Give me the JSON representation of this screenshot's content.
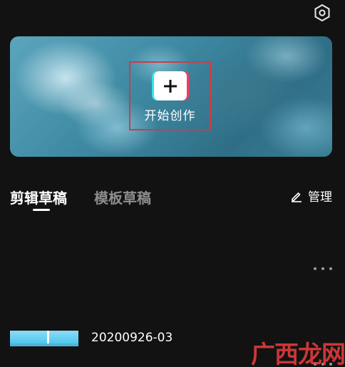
{
  "header": {
    "settings_icon": "settings-hexagon-icon"
  },
  "banner": {
    "create_label": "开始创作",
    "plus_icon": "plus-icon",
    "highlight_color": "#d23a45"
  },
  "tabs": [
    {
      "label": "剪辑草稿",
      "active": true
    },
    {
      "label": "模板草稿",
      "active": false
    }
  ],
  "manage": {
    "icon": "pencil-icon",
    "label": "管理"
  },
  "drafts": [
    {
      "title": "20200926-03"
    }
  ],
  "watermark": {
    "text": "广西龙网"
  }
}
